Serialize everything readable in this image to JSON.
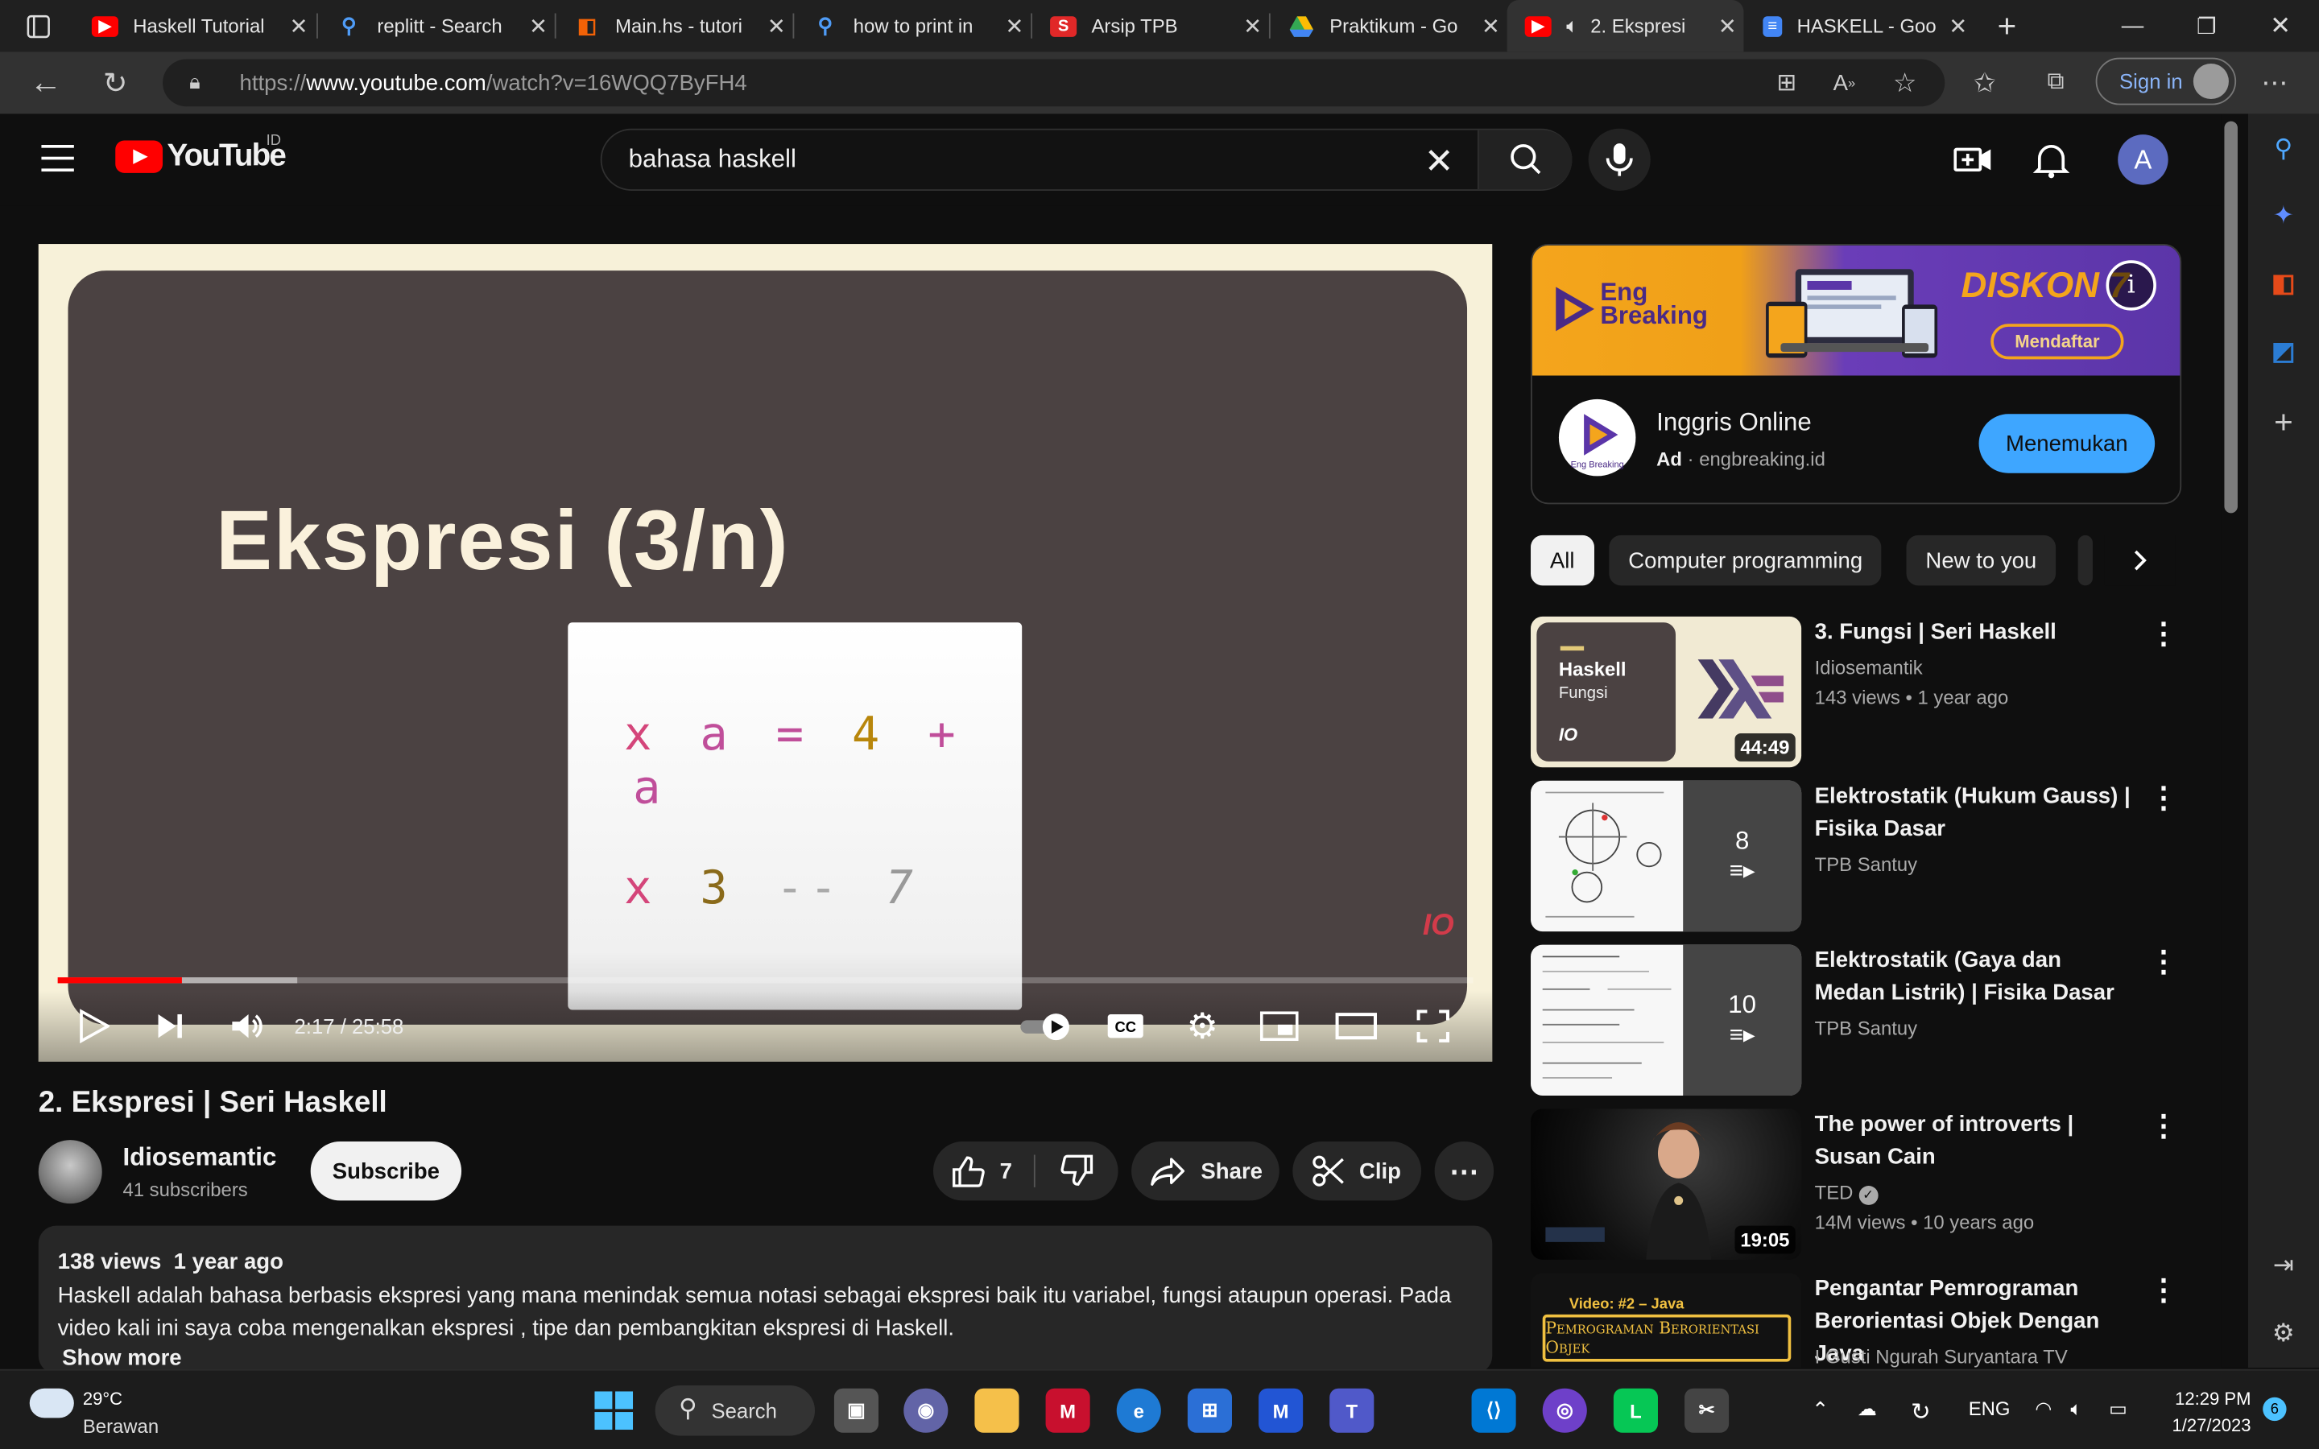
{
  "browser": {
    "tabs": [
      {
        "label": "Haskell Tutorial",
        "icon": "youtube-icon"
      },
      {
        "label": "replitt - Search",
        "icon": "search-icon"
      },
      {
        "label": "Main.hs - tutori",
        "icon": "replit-icon"
      },
      {
        "label": "how to print in",
        "icon": "search-icon"
      },
      {
        "label": "Arsip TPB",
        "icon": "scribd-icon"
      },
      {
        "label": "Praktikum - Go",
        "icon": "google-drive-icon"
      },
      {
        "label": "2. Ekspresi",
        "icon": "youtube-icon"
      },
      {
        "label": "HASKELL - Goo",
        "icon": "google-docs-icon"
      }
    ],
    "url_prefix": "https://",
    "url_host": "www.youtube.com",
    "url_path": "/watch?v=16WQQ7ByFH4",
    "sign_in": "Sign in"
  },
  "youtube": {
    "logo_text": "YouTube",
    "country": "ID",
    "search_value": "bahasa haskell",
    "avatar_letter": "A"
  },
  "player": {
    "slide_title": "Ekspresi  (3/n)",
    "code_line1": [
      "x",
      "a",
      "=",
      "4",
      "+",
      "a"
    ],
    "code_line2": [
      "x",
      "3",
      "--",
      "7"
    ],
    "watermark": "IO",
    "time": "2:17 / 25:58",
    "progress_played": 0.088,
    "progress_buffered": 0.169
  },
  "video": {
    "title": "2. Ekspresi | Seri Haskell",
    "channel": "Idiosemantic",
    "subscribers": "41 subscribers",
    "subscribe": "Subscribe",
    "likes": "7",
    "share": "Share",
    "clip": "Clip",
    "views": "138 views",
    "age": "1 year ago",
    "description": "Haskell adalah bahasa berbasis ekspresi yang mana menindak semua notasi sebagai ekspresi baik itu variabel, fungsi ataupun operasi. Pada video kali ini saya coba mengenalkan ekspresi , tipe  dan pembangkitan ekspresi di Haskell.",
    "show_more": "Show more"
  },
  "ad": {
    "brand_line1": "Eng",
    "brand_line2": "Breaking",
    "promo": "DISKON 7",
    "promo_button": "Mendaftar",
    "title": "Inggris Online",
    "ad_label": "Ad",
    "domain": "engbreaking.id",
    "cta": "Menemukan",
    "logo_caption": "Eng Breaking"
  },
  "chips": [
    "All",
    "Computer programming",
    "New to you"
  ],
  "recommendations": [
    {
      "title": "3. Fungsi | Seri Haskell",
      "channel": "Idiosemantik",
      "meta": "143 views  • 1 year ago",
      "duration": "44:49",
      "thumb_title": "Haskell",
      "thumb_sub": "Fungsi",
      "thumb_io": "IO"
    },
    {
      "title": "Elektrostatik (Hukum Gauss) | Fisika Dasar",
      "channel": "TPB Santuy",
      "playlist_count": "8"
    },
    {
      "title": "Elektrostatik (Gaya dan Medan Listrik) | Fisika Dasar",
      "channel": "TPB Santuy",
      "playlist_count": "10"
    },
    {
      "title": "The power of introverts | Susan Cain",
      "channel": "TED",
      "meta": "14M views  • 10 years ago",
      "duration": "19:05"
    },
    {
      "title": "Pengantar Pemrograman Berorientasi Objek Dengan Java",
      "channel": "I Gusti Ngurah Suryantara TV",
      "thumb_tag": "Video: #2 – Java",
      "thumb_title": "Pemrograman Berorientasi Objek"
    }
  ],
  "taskbar": {
    "temp": "29°C",
    "weather": "Berawan",
    "search": "Search",
    "lang": "ENG",
    "time": "12:29 PM",
    "date": "1/27/2023",
    "notifications": "6"
  },
  "colors": {
    "youtube_red": "#ff0000",
    "accent_blue": "#3ea6ff",
    "background": "#0f0f0f"
  }
}
